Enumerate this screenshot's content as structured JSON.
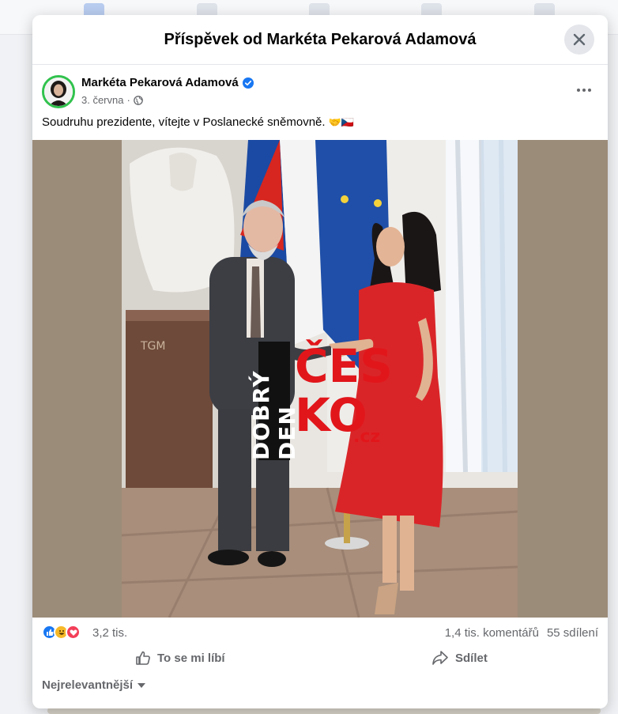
{
  "modal": {
    "title": "Příspěvek od Markéta Pekarová Adamová"
  },
  "post": {
    "author": "Markéta Pekarová Adamová",
    "date": "3. června",
    "separator": "·",
    "text": "Soudruhu prezidente, vítejte v Poslanecké sněmovně.",
    "text_emojis": "🤝🇨🇿"
  },
  "watermark": {
    "vertical": "DOBRÝ DEN",
    "line1": "ČES",
    "line2": "KO",
    "suffix": ".cz"
  },
  "stats": {
    "reactions_count": "3,2 tis.",
    "comments": "1,4 tis. komentářů",
    "shares": "55 sdílení"
  },
  "actions": {
    "like": "To se mi líbí",
    "share": "Sdílet"
  },
  "comments": {
    "sort_label": "Nejrelevantnější"
  },
  "colors": {
    "accent": "#1877f2",
    "avatar_ring": "#31c24d",
    "watermark_red": "#e1161b"
  }
}
